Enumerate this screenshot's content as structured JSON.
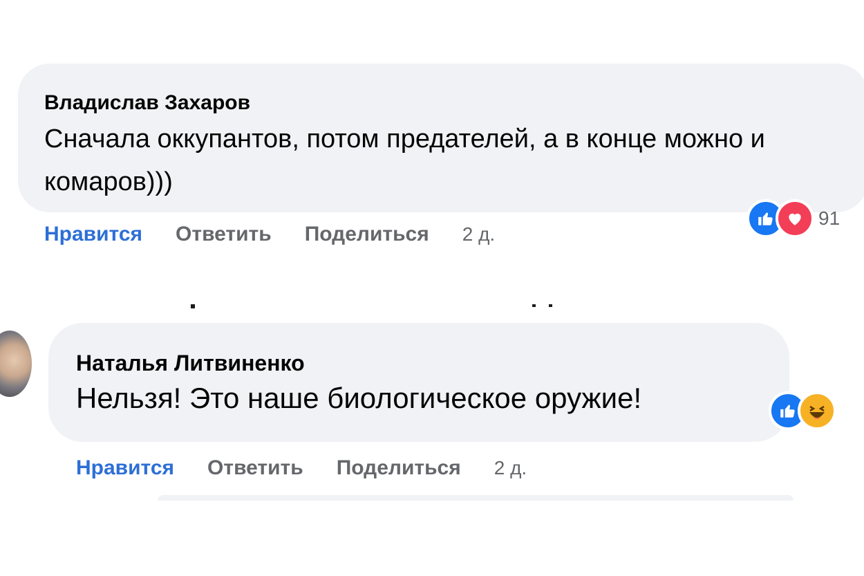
{
  "comments": [
    {
      "author": "Владислав Захаров",
      "text": "Сначала оккупантов, потом предателей, а в конце можно и комаров)))",
      "actions": {
        "like": "Нравится",
        "reply": "Ответить",
        "share": "Поделиться",
        "time": "2 д."
      },
      "reactions": {
        "icons": [
          "like-icon",
          "love-icon"
        ],
        "count": "91"
      }
    },
    {
      "author": "Наталья Литвиненко",
      "text": "Нельзя! Это наше биологическое оружие!",
      "actions": {
        "like": "Нравится",
        "reply": "Ответить",
        "share": "Поделиться",
        "time": "2 д."
      },
      "reactions": {
        "icons": [
          "like-icon",
          "haha-icon"
        ]
      }
    }
  ],
  "colors": {
    "bubble": "#f0f2f5",
    "like_text": "#2d6fd6",
    "secondary_text": "#65676b",
    "like_reaction": "#1877f2",
    "love_reaction": "#f33e58",
    "haha_reaction": "#f7b125"
  }
}
